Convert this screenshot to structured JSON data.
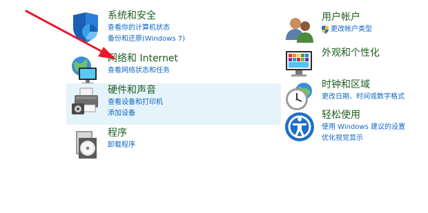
{
  "left": [
    {
      "icon": "security-shield-icon",
      "title": "系统和安全",
      "links": [
        "查看你的计算机状态",
        "备份和还原(Windows 7)"
      ]
    },
    {
      "icon": "network-globe-icon",
      "title": "网络和 Internet",
      "links": [
        "查看网络状态和任务"
      ]
    },
    {
      "icon": "printer-icon",
      "title": "硬件和声音",
      "links": [
        "查看设备和打印机",
        "添加设备"
      ]
    },
    {
      "icon": "programs-disc-icon",
      "title": "程序",
      "links": [
        "卸载程序"
      ]
    }
  ],
  "right": [
    {
      "icon": "users-icon",
      "title": "用户帐户",
      "links": [
        "更改帐户类型"
      ]
    },
    {
      "icon": "appearance-monitor-icon",
      "title": "外观和个性化",
      "links": []
    },
    {
      "icon": "clock-globe-icon",
      "title": "时钟和区域",
      "links": [
        "更改日期、时间或数字格式"
      ]
    },
    {
      "icon": "ease-of-access-icon",
      "title": "轻松使用",
      "links": [
        "使用 Windows 建议的设置",
        "优化视觉显示"
      ]
    }
  ],
  "colors": {
    "title": "#1e5c20",
    "link": "#0d66c2",
    "hover_bg": "#e5f3fb",
    "arrow": "#e8192c"
  }
}
